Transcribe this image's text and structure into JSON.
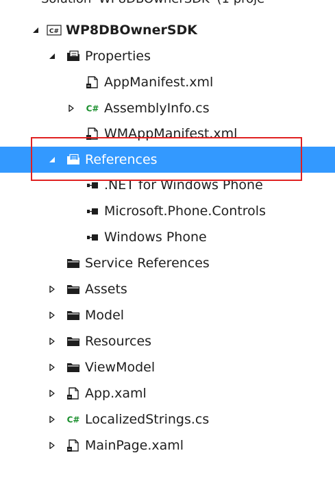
{
  "header_partial_text": "Solution 'WP8DBOwnerSDK' (1 proje",
  "colors": {
    "selection": "#3399ff",
    "highlight_border": "#e02020",
    "csharp_green": "#1a8f2d"
  },
  "tree": [
    {
      "key": "project",
      "label": "WP8DBOwnerSDK",
      "icon": "csharp-project-icon",
      "expander": "expanded",
      "bold": true
    },
    {
      "key": "properties",
      "label": "Properties",
      "icon": "properties-folder-icon",
      "expander": "expanded"
    },
    {
      "key": "app-manifest",
      "label": "AppManifest.xml",
      "icon": "xml-file-icon",
      "expander": "none"
    },
    {
      "key": "assembly-info",
      "label": "AssemblyInfo.cs",
      "icon": "csharp-file-icon",
      "expander": "collapsed"
    },
    {
      "key": "wm-app-manifest",
      "label": "WMAppManifest.xml",
      "icon": "xml-file-icon",
      "expander": "none"
    },
    {
      "key": "references",
      "label": "References",
      "icon": "references-folder-icon",
      "expander": "expanded",
      "selected": true
    },
    {
      "key": "ref-net",
      "label": ".NET for Windows Phone",
      "icon": "assembly-reference-icon",
      "expander": "none"
    },
    {
      "key": "ref-phone-controls",
      "label": "Microsoft.Phone.Controls",
      "icon": "assembly-reference-icon",
      "expander": "none"
    },
    {
      "key": "ref-windows-phone",
      "label": "Windows Phone",
      "icon": "assembly-reference-icon",
      "expander": "none"
    },
    {
      "key": "service-references",
      "label": "Service References",
      "icon": "folder-icon",
      "expander": "none"
    },
    {
      "key": "assets",
      "label": "Assets",
      "icon": "folder-icon",
      "expander": "collapsed"
    },
    {
      "key": "model",
      "label": "Model",
      "icon": "folder-icon",
      "expander": "collapsed"
    },
    {
      "key": "resources",
      "label": "Resources",
      "icon": "folder-icon",
      "expander": "collapsed"
    },
    {
      "key": "viewmodel",
      "label": "ViewModel",
      "icon": "folder-icon",
      "expander": "collapsed"
    },
    {
      "key": "app-xaml",
      "label": "App.xaml",
      "icon": "xaml-file-icon",
      "expander": "collapsed"
    },
    {
      "key": "localized-strings",
      "label": "LocalizedStrings.cs",
      "icon": "csharp-file-icon",
      "expander": "collapsed"
    },
    {
      "key": "main-page",
      "label": "MainPage.xaml",
      "icon": "xaml-file-icon",
      "expander": "collapsed"
    }
  ]
}
